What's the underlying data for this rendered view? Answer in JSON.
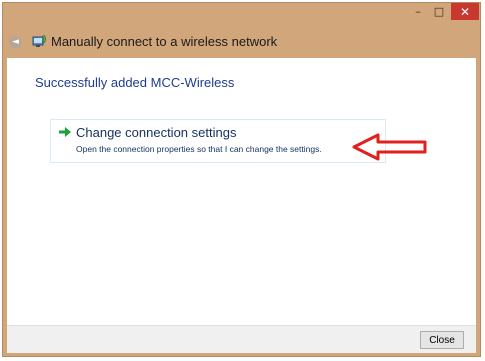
{
  "window": {
    "title": "Manually connect to a wireless network",
    "controls": {
      "minimize": "–",
      "maximize": "□",
      "close": "✕"
    },
    "back_glyph": "◄"
  },
  "main": {
    "heading": "Successfully added MCC-Wireless",
    "action": {
      "title": "Change connection settings",
      "description": "Open the connection properties so that I can change the settings.",
      "icon": "green-arrow-icon"
    },
    "annotation": {
      "icon": "red-arrow-icon",
      "color": "#e0201d"
    }
  },
  "footer": {
    "close_label": "Close"
  },
  "colors": {
    "frame": "#d2a67b",
    "heading": "#1f3d8f",
    "link": "#15305d",
    "close_button": "#c7392f",
    "arrow_green": "#1aa33a"
  }
}
